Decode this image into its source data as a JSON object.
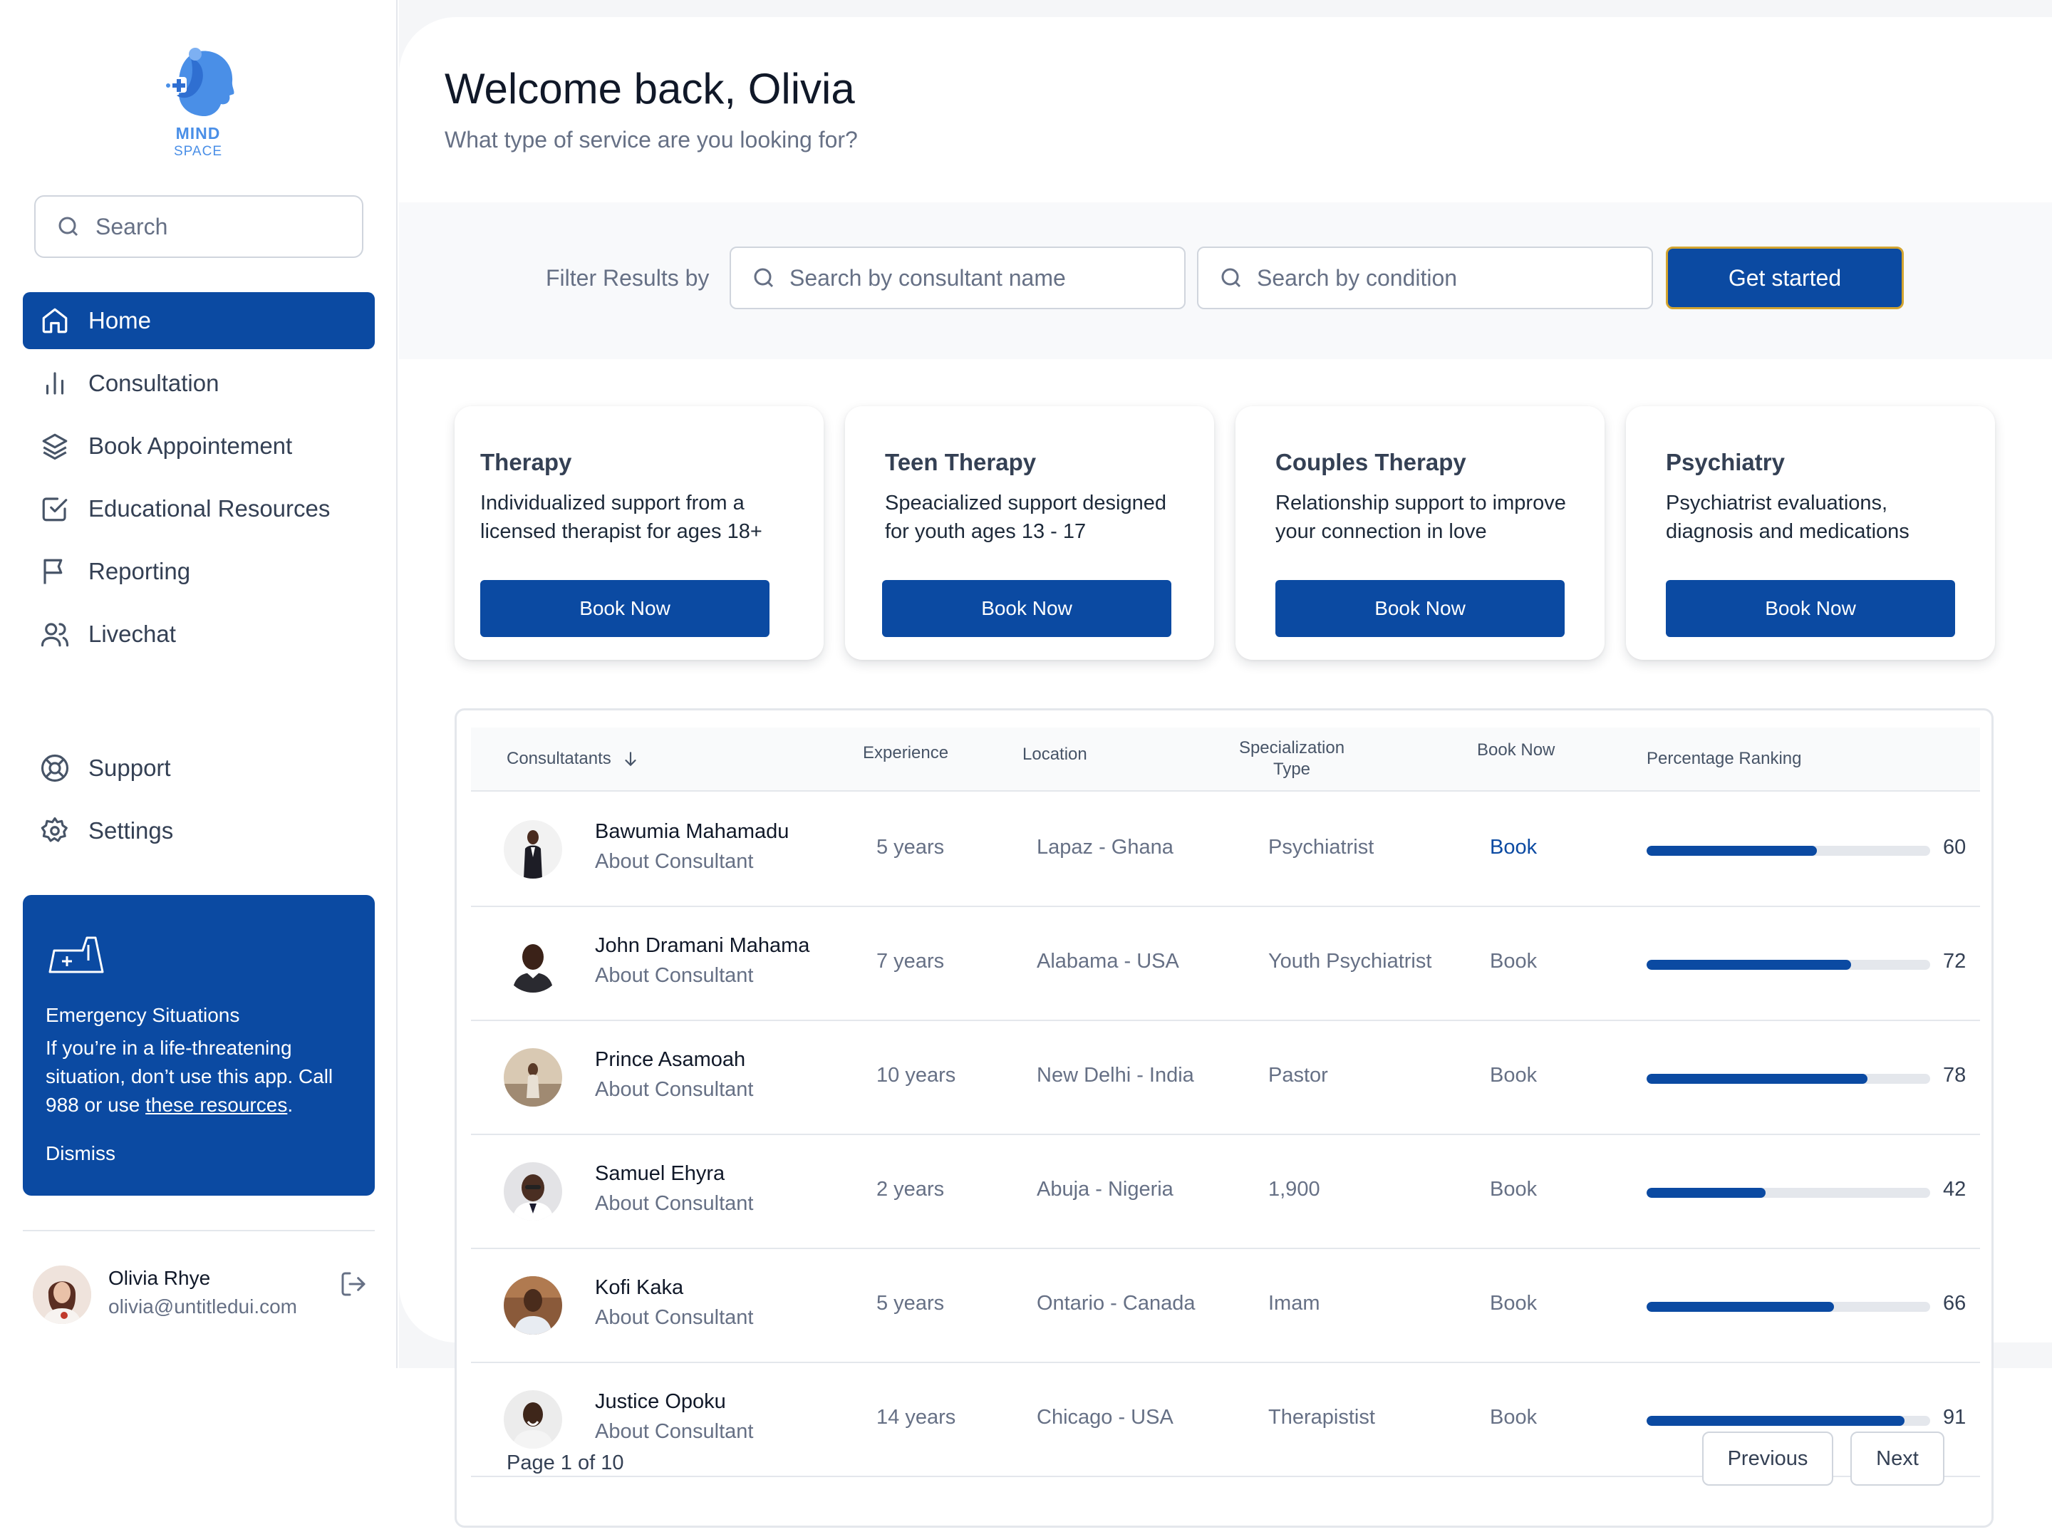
{
  "brand": {
    "name_line1": "MIND",
    "name_line2": "SPACE",
    "color": "#4a8fe7"
  },
  "accent_color": "#0b4aa2",
  "sidebar": {
    "search_placeholder": "Search",
    "nav_items": [
      {
        "label": "Home",
        "icon": "home-icon",
        "active": true
      },
      {
        "label": "Consultation",
        "icon": "bar-chart-icon"
      },
      {
        "label": "Book Appointement",
        "icon": "layers-icon"
      },
      {
        "label": "Educational Resources",
        "icon": "check-square-icon"
      },
      {
        "label": "Reporting",
        "icon": "flag-icon"
      },
      {
        "label": "Livechat",
        "icon": "users-icon"
      }
    ],
    "secondary_items": [
      {
        "label": "Support",
        "icon": "life-buoy-icon"
      },
      {
        "label": "Settings",
        "icon": "gear-icon"
      }
    ],
    "emergency": {
      "title": "Emergency Situations",
      "body_prefix": "If you’re in a life-threatening situation, don’t use this app. Call 988 or use ",
      "link_text": "these resources",
      "body_suffix": ".",
      "dismiss": "Dismiss"
    },
    "user": {
      "name": "Olivia Rhye",
      "email": "olivia@untitledui.com"
    }
  },
  "header": {
    "title": "Welcome back, Olivia",
    "subtitle": "What type of service are you looking for?"
  },
  "filter": {
    "label": "Filter Results by",
    "consultant_placeholder": "Search by consultant name",
    "condition_placeholder": "Search by condition",
    "button": "Get started"
  },
  "services": [
    {
      "title": "Therapy",
      "description": "Individualized support from a licensed therapist for ages 18+",
      "button": "Book Now"
    },
    {
      "title": "Teen Therapy",
      "description": "Speacialized support designed for youth ages 13 - 17",
      "button": "Book Now"
    },
    {
      "title": "Couples Therapy",
      "description": "Relationship support to improve your connection in love",
      "button": "Book Now"
    },
    {
      "title": "Psychiatry",
      "description": "Psychiatrist evaluations, diagnosis and medications",
      "button": "Book Now"
    }
  ],
  "table": {
    "headers": {
      "consultants": "Consultatants",
      "experience": "Experience",
      "location": "Location",
      "specialization_1": "Specialization",
      "specialization_2": "Type",
      "book": "Book Now",
      "ranking": "Percentage Ranking"
    },
    "rows": [
      {
        "name": "Bawumia Mahamadu",
        "about": "About Consultant",
        "experience": "5 years",
        "location": "Lapaz - Ghana",
        "specialization": "Psychiatrist",
        "book": "Book",
        "ranking": 60
      },
      {
        "name": "John Dramani Mahama",
        "about": "About Consultant",
        "experience": "7 years",
        "location": "Alabama - USA",
        "specialization": "Youth Psychiatrist",
        "book": "Book",
        "ranking": 72
      },
      {
        "name": "Prince Asamoah",
        "about": "About Consultant",
        "experience": "10 years",
        "location": "New Delhi - India",
        "specialization": "Pastor",
        "book": "Book",
        "ranking": 78
      },
      {
        "name": "Samuel Ehyra",
        "about": "About Consultant",
        "experience": "2 years",
        "location": "Abuja - Nigeria",
        "specialization": "1,900",
        "book": "Book",
        "ranking": 42
      },
      {
        "name": "Kofi Kaka",
        "about": "About Consultant",
        "experience": "5 years",
        "location": "Ontario - Canada",
        "specialization": "Imam",
        "book": "Book",
        "ranking": 66
      },
      {
        "name": "Justice Opoku",
        "about": "About Consultant",
        "experience": "14 years",
        "location": "Chicago - USA",
        "specialization": "Therapistist",
        "book": "Book",
        "ranking": 91
      }
    ],
    "pagination": {
      "text": "Page 1 of 10",
      "previous": "Previous",
      "next": "Next"
    }
  }
}
